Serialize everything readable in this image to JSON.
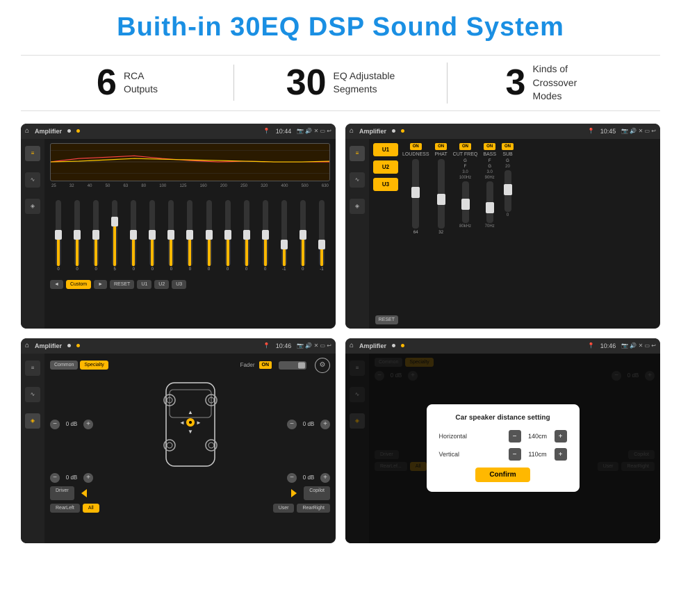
{
  "page": {
    "main_title": "Buith-in 30EQ DSP Sound System",
    "stats": [
      {
        "number": "6",
        "desc_line1": "RCA",
        "desc_line2": "Outputs"
      },
      {
        "number": "30",
        "desc_line1": "EQ Adjustable",
        "desc_line2": "Segments"
      },
      {
        "number": "3",
        "desc_line1": "Kinds of",
        "desc_line2": "Crossover Modes"
      }
    ],
    "panels": [
      {
        "id": "eq-panel",
        "top_bar": {
          "title": "Amplifier",
          "time": "10:44"
        },
        "eq_bands": [
          "25",
          "32",
          "40",
          "50",
          "63",
          "80",
          "100",
          "125",
          "160",
          "200",
          "250",
          "320",
          "400",
          "500",
          "630"
        ],
        "eq_values": [
          "0",
          "0",
          "0",
          "5",
          "0",
          "0",
          "0",
          "0",
          "0",
          "0",
          "0",
          "0",
          "-1",
          "0",
          "-1"
        ],
        "eq_slider_heights": [
          50,
          50,
          50,
          70,
          50,
          50,
          50,
          50,
          50,
          50,
          50,
          50,
          35,
          50,
          35
        ],
        "eq_thumb_positions": [
          45,
          45,
          45,
          25,
          45,
          45,
          45,
          45,
          45,
          45,
          45,
          45,
          60,
          45,
          60
        ],
        "bottom_btns": [
          "◄",
          "Custom",
          "►",
          "RESET",
          "U1",
          "U2",
          "U3"
        ]
      },
      {
        "id": "crossover-panel",
        "top_bar": {
          "title": "Amplifier",
          "time": "10:45"
        },
        "presets": [
          "U1",
          "U2",
          "U3"
        ],
        "groups": [
          {
            "toggle": "ON",
            "label": "LOUDNESS",
            "val": ""
          },
          {
            "toggle": "ON",
            "label": "PHAT",
            "val": ""
          },
          {
            "toggle": "ON",
            "label": "CUT FREQ",
            "val": ""
          },
          {
            "toggle": "ON",
            "label": "BASS",
            "val": ""
          },
          {
            "toggle": "ON",
            "label": "SUB",
            "val": ""
          }
        ]
      },
      {
        "id": "fader-panel",
        "top_bar": {
          "title": "Amplifier",
          "time": "10:46"
        },
        "modes": [
          "Common",
          "Specialty"
        ],
        "fader_label": "Fader",
        "fader_on": "ON",
        "db_rows": [
          {
            "value": "0 dB"
          },
          {
            "value": "0 dB"
          },
          {
            "value": "0 dB"
          },
          {
            "value": "0 dB"
          }
        ],
        "bottom_btns": [
          "Driver",
          "RearLeft",
          "All",
          "User",
          "RearRight",
          "Copilot"
        ]
      },
      {
        "id": "dialog-panel",
        "top_bar": {
          "title": "Amplifier",
          "time": "10:46"
        },
        "modes": [
          "Common",
          "Specialty"
        ],
        "dialog": {
          "title": "Car speaker distance setting",
          "rows": [
            {
              "label": "Horizontal",
              "value": "140cm"
            },
            {
              "label": "Vertical",
              "value": "110cm"
            }
          ],
          "confirm_label": "Confirm"
        },
        "side_values": [
          {
            "value": "0 dB"
          },
          {
            "value": "0 dB"
          }
        ],
        "bottom_btns": [
          "Driver",
          "RearLef...",
          "All",
          "User",
          "RearRight",
          "Copilot"
        ]
      }
    ]
  }
}
